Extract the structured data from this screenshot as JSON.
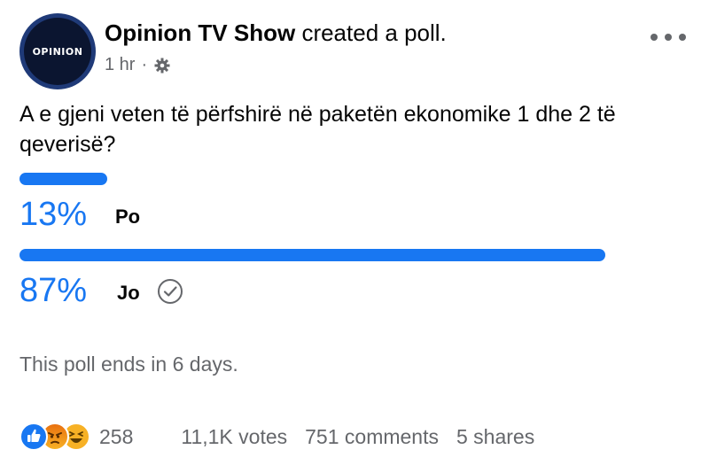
{
  "post": {
    "avatar_text": "OPINION",
    "page_name": "Opinion TV Show",
    "action": "created a poll.",
    "time": "1 hr",
    "privacy_icon": "gear-icon",
    "more_icon": "more-options-icon"
  },
  "poll": {
    "question": "A e gjeni veten të përfshirë në paketën ekonomike 1 dhe 2 të qeverisë?",
    "options": [
      {
        "percent_text": "13%",
        "percent": 13,
        "label": "Po",
        "selected": false
      },
      {
        "percent_text": "87%",
        "percent": 87,
        "label": "Jo",
        "selected": true
      }
    ],
    "ends_text": "This poll ends in 6 days.",
    "accent_color": "#1877f2"
  },
  "footer": {
    "reactions": [
      "like-icon",
      "angry-icon",
      "haha-icon"
    ],
    "reaction_count": "258",
    "votes": "11,1K votes",
    "comments": "751 comments",
    "shares": "5 shares"
  }
}
